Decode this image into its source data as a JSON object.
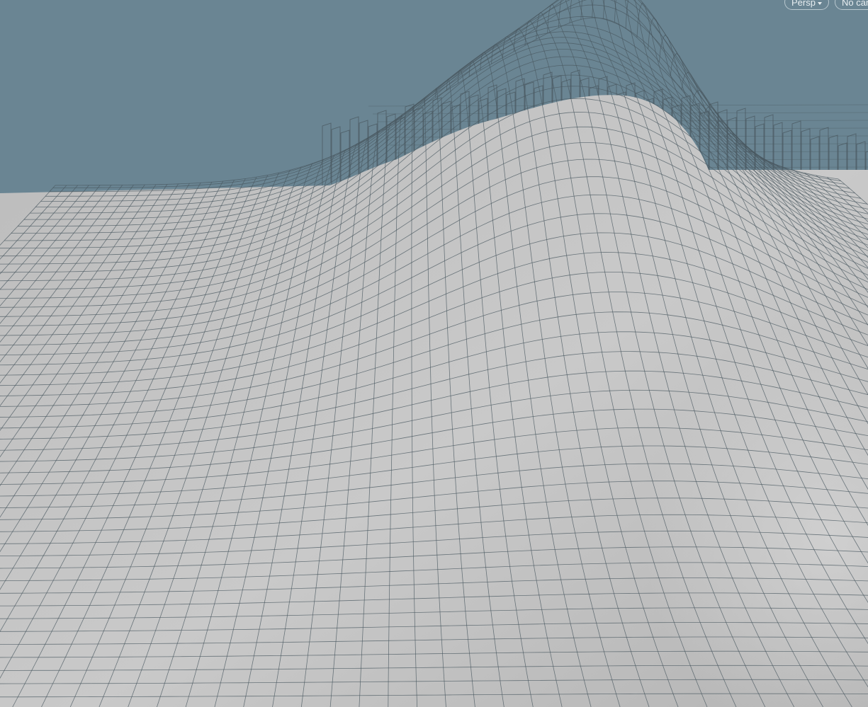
{
  "viewport": {
    "background_color": "#6a8593",
    "surface_color": "#c6c6c6",
    "wire_color": "#4a5860",
    "view_menu": {
      "label": "Persp",
      "icon": "chevron-down-icon"
    },
    "camera_menu": {
      "label": "No cam"
    }
  }
}
